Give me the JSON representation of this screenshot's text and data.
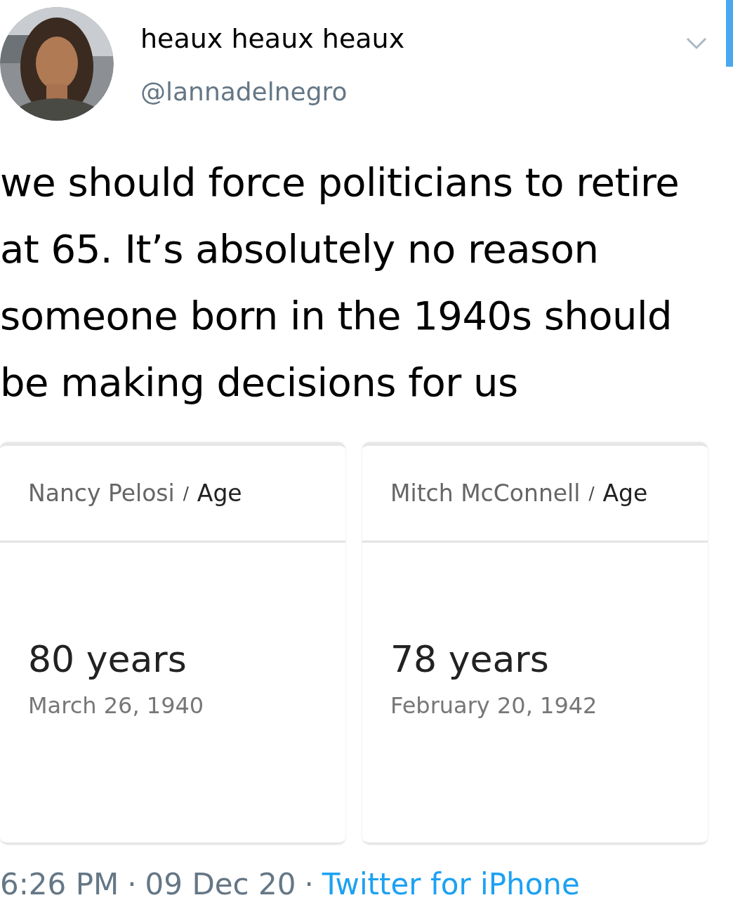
{
  "author": {
    "name": "heaux heaux heaux",
    "handle": "@lannadelnegro"
  },
  "tweet_text": "we should force politicians to retire at 65. It’s absolutely no reason someone born in the 1940s should be making decisions for us",
  "cards": [
    {
      "subject": "Nancy Pelosi",
      "separator": "/",
      "attribute": "Age",
      "value": "80 years",
      "date": "March 26, 1940"
    },
    {
      "subject": "Mitch McConnell",
      "separator": "/",
      "attribute": "Age",
      "value": "78 years",
      "date": "February 20, 1942"
    }
  ],
  "footer": {
    "time": "6:26 PM",
    "separator_1": "·",
    "date": "09 Dec 20",
    "separator_2": "·",
    "source": "Twitter for iPhone"
  }
}
